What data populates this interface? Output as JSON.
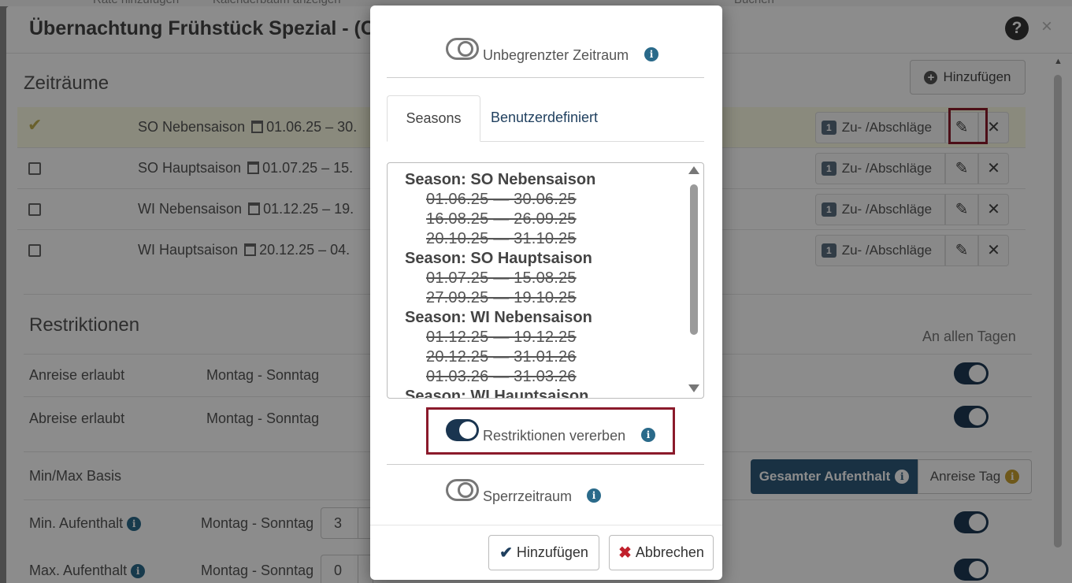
{
  "background": {
    "top_strip": [
      "Rate hinzufügen",
      "Kalenderbaum anzeigen",
      "Buchen"
    ],
    "panel_title": "Übernachtung Frühstück Spezial - (C",
    "help_icon": "question-circle-icon",
    "close_icon": "×",
    "zeitraeume": {
      "heading": "Zeiträume",
      "add_button": "Hinzufügen",
      "rows": [
        {
          "name": "SO Nebensaison",
          "dates": "01.06.25 – 30.",
          "selected": true
        },
        {
          "name": "SO Hauptsaison",
          "dates": "01.07.25 – 15.",
          "selected": false
        },
        {
          "name": "WI Nebensaison",
          "dates": "01.12.25 – 19.",
          "selected": false
        },
        {
          "name": "WI Hauptsaison",
          "dates": "20.12.25 – 04.",
          "selected": false
        }
      ],
      "badge": "1",
      "zu_label": "Zu- /Abschläge",
      "edit_icon": "✎",
      "delete_icon": "✕"
    },
    "restriktionen": {
      "heading": "Restriktionen",
      "an_allen_tagen": "An allen Tagen",
      "anreise_label": "Anreise erlaubt",
      "anreise_value": "Montag - Sonntag",
      "abreise_label": "Abreise erlaubt",
      "abreise_value": "Montag - Sonntag",
      "minmax_label": "Min/Max Basis",
      "seg_active": "Gesamter Aufenthalt",
      "seg_inactive": "Anreise Tag",
      "min_label": "Min. Aufenthalt",
      "min_days": "Montag - Sonntag",
      "min_value": "3",
      "max_label": "Max. Aufenthalt",
      "max_days": "Montag - Sonntag",
      "max_value": "0"
    }
  },
  "modal": {
    "unbegrenzt_label": "Unbegrenzter Zeitraum",
    "unbegrenzt_on": false,
    "info_glyph": "i",
    "tabs": [
      {
        "label": "Seasons",
        "active": true
      },
      {
        "label": "Benutzerdefiniert",
        "active": false
      }
    ],
    "seasons": [
      {
        "title": "Season: SO Nebensaison",
        "ranges": [
          "01.06.25 — 30.06.25",
          "16.08.25 — 26.09.25",
          "20.10.25 — 31.10.25"
        ]
      },
      {
        "title": "Season: SO Hauptsaison",
        "ranges": [
          "01.07.25 — 15.08.25",
          "27.09.25 — 19.10.25"
        ]
      },
      {
        "title": "Season: WI Nebensaison",
        "ranges": [
          "01.12.25 — 19.12.25",
          "20.12.25 — 31.01.26",
          "01.03.26 — 31.03.26"
        ]
      },
      {
        "title": "Season: WI Hauptsaison",
        "ranges": []
      }
    ],
    "restriktionen_label": "Restriktionen vererben",
    "restriktionen_on": true,
    "sperr_label": "Sperrzeitraum",
    "sperr_on": false,
    "confirm_button": "Hinzufügen",
    "confirm_icon": "✔",
    "cancel_button": "Abbrechen",
    "cancel_icon": "✖"
  }
}
